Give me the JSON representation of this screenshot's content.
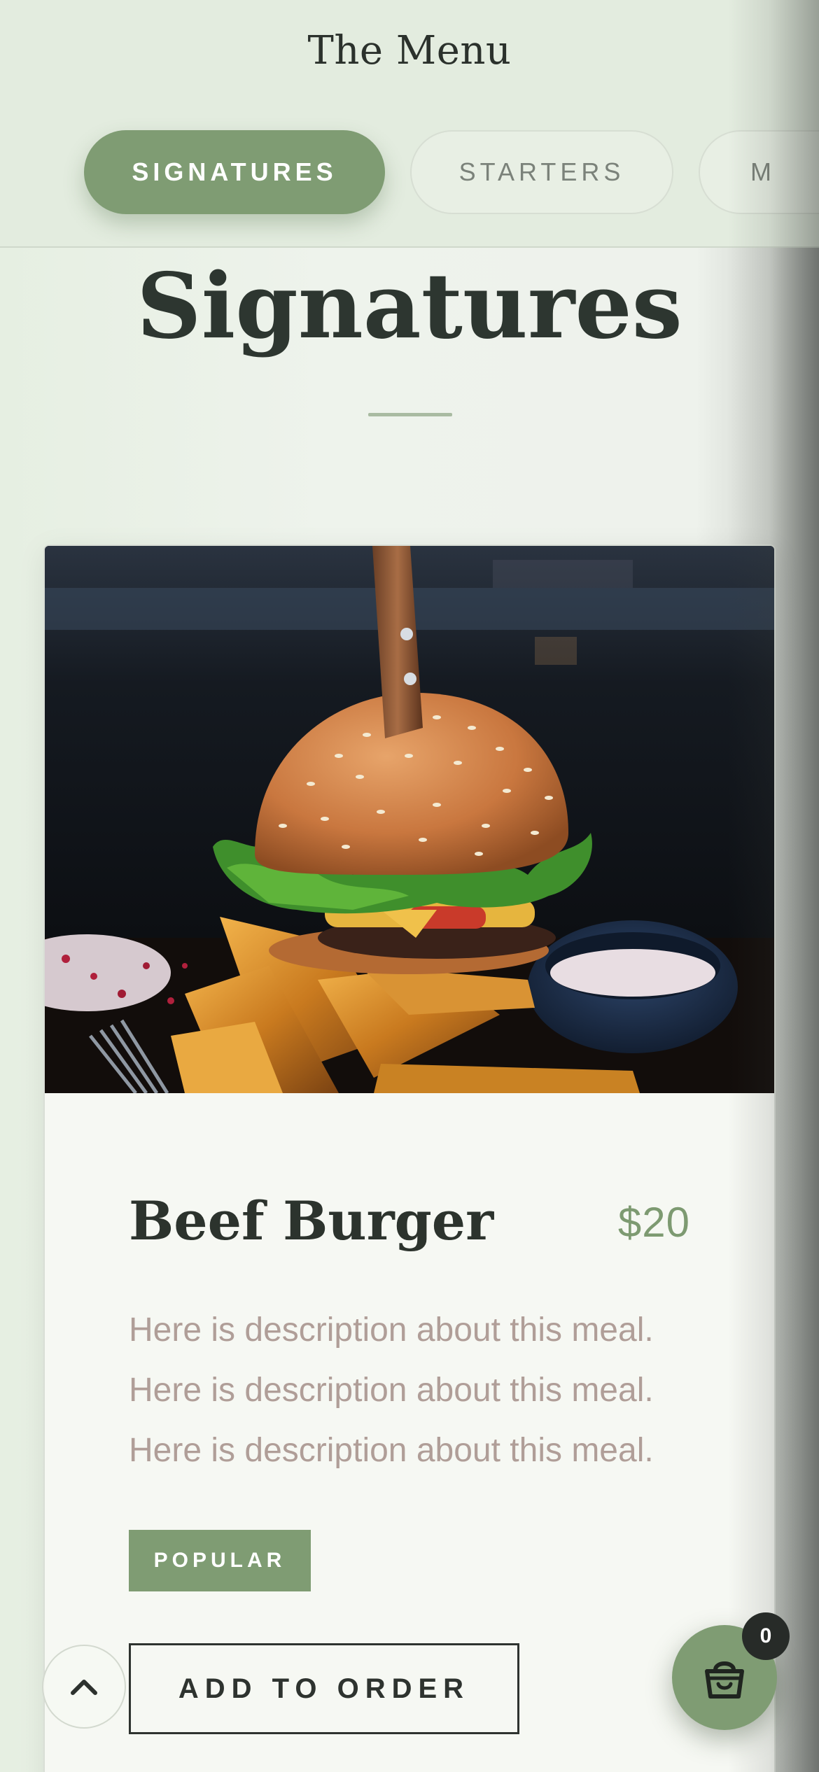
{
  "header": {
    "title": "The Menu",
    "tabs": [
      {
        "label": "SIGNATURES",
        "active": true
      },
      {
        "label": "STARTERS",
        "active": false
      },
      {
        "label": "M",
        "active": false
      }
    ]
  },
  "section": {
    "title": "Signatures"
  },
  "item": {
    "name": "Beef Burger",
    "price": "$20",
    "description_lines": [
      "Here is description about this meal.",
      "Here is description about this meal.",
      "Here is description about this meal."
    ],
    "badge": "POPULAR",
    "add_button": "ADD TO ORDER",
    "image_subject": "burger-with-potato-wedges"
  },
  "cart": {
    "count": "0",
    "icon": "shopping-basket-icon"
  },
  "scroll_top": {
    "icon": "chevron-up-icon"
  },
  "colors": {
    "accent": "#7f9c73",
    "background": "#e7eee2",
    "text_dark": "#2c332d",
    "description": "#b09e98"
  }
}
